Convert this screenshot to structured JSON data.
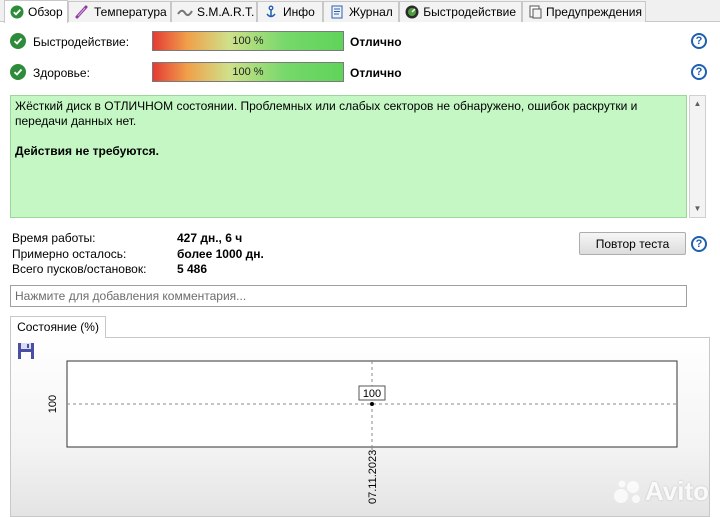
{
  "tabs": [
    {
      "label": "Обзор",
      "icon": "check-shield-icon",
      "active": true
    },
    {
      "label": "Температура",
      "icon": "thermometer-icon",
      "active": false
    },
    {
      "label": "S.M.A.R.T.",
      "icon": "smart-icon",
      "active": false
    },
    {
      "label": "Инфо",
      "icon": "info-anchor-icon",
      "active": false
    },
    {
      "label": "Журнал",
      "icon": "journal-icon",
      "active": false
    },
    {
      "label": "Быстродействие",
      "icon": "speedometer-icon",
      "active": false
    },
    {
      "label": "Предупреждения",
      "icon": "warning-doc-icon",
      "active": false
    }
  ],
  "performance": {
    "label": "Быстродействие:",
    "value": "100 %",
    "level": 100,
    "verdict": "Отлично"
  },
  "health": {
    "label": "Здоровье:",
    "value": "100 %",
    "level": 100,
    "verdict": "Отлично"
  },
  "help_label": "?",
  "message": {
    "line1": "Жёсткий диск в ОТЛИЧНОМ состоянии. Проблемных или слабых секторов не обнаружено, ошибок раскрутки и передачи данных нет.",
    "line2": "Действия не требуются."
  },
  "stats": {
    "uptime_label": "Время работы:",
    "uptime_value": "427 дн., 6 ч",
    "remaining_label": "Примерно осталось:",
    "remaining_value": "более 1000 дн.",
    "starts_label": "Всего пусков/остановок:",
    "starts_value": "5 486"
  },
  "retest_button": "Повтор теста",
  "comment_placeholder": "Нажмите для добавления комментария...",
  "chart_tab": "Состояние (%)",
  "chart_data": {
    "type": "line",
    "title": "Состояние (%)",
    "x": [
      "07.11.2023"
    ],
    "series": [
      {
        "values": [
          100
        ]
      }
    ],
    "y_tick_labels": [
      "100"
    ],
    "x_tick_labels": [
      "07.11.2023"
    ],
    "data_labels": [
      "100"
    ],
    "grid": true
  },
  "colors": {
    "ok": "#2e8b3a",
    "message_bg": "#c4f7c4",
    "help": "#1f5fb0"
  },
  "watermark": "Avito"
}
